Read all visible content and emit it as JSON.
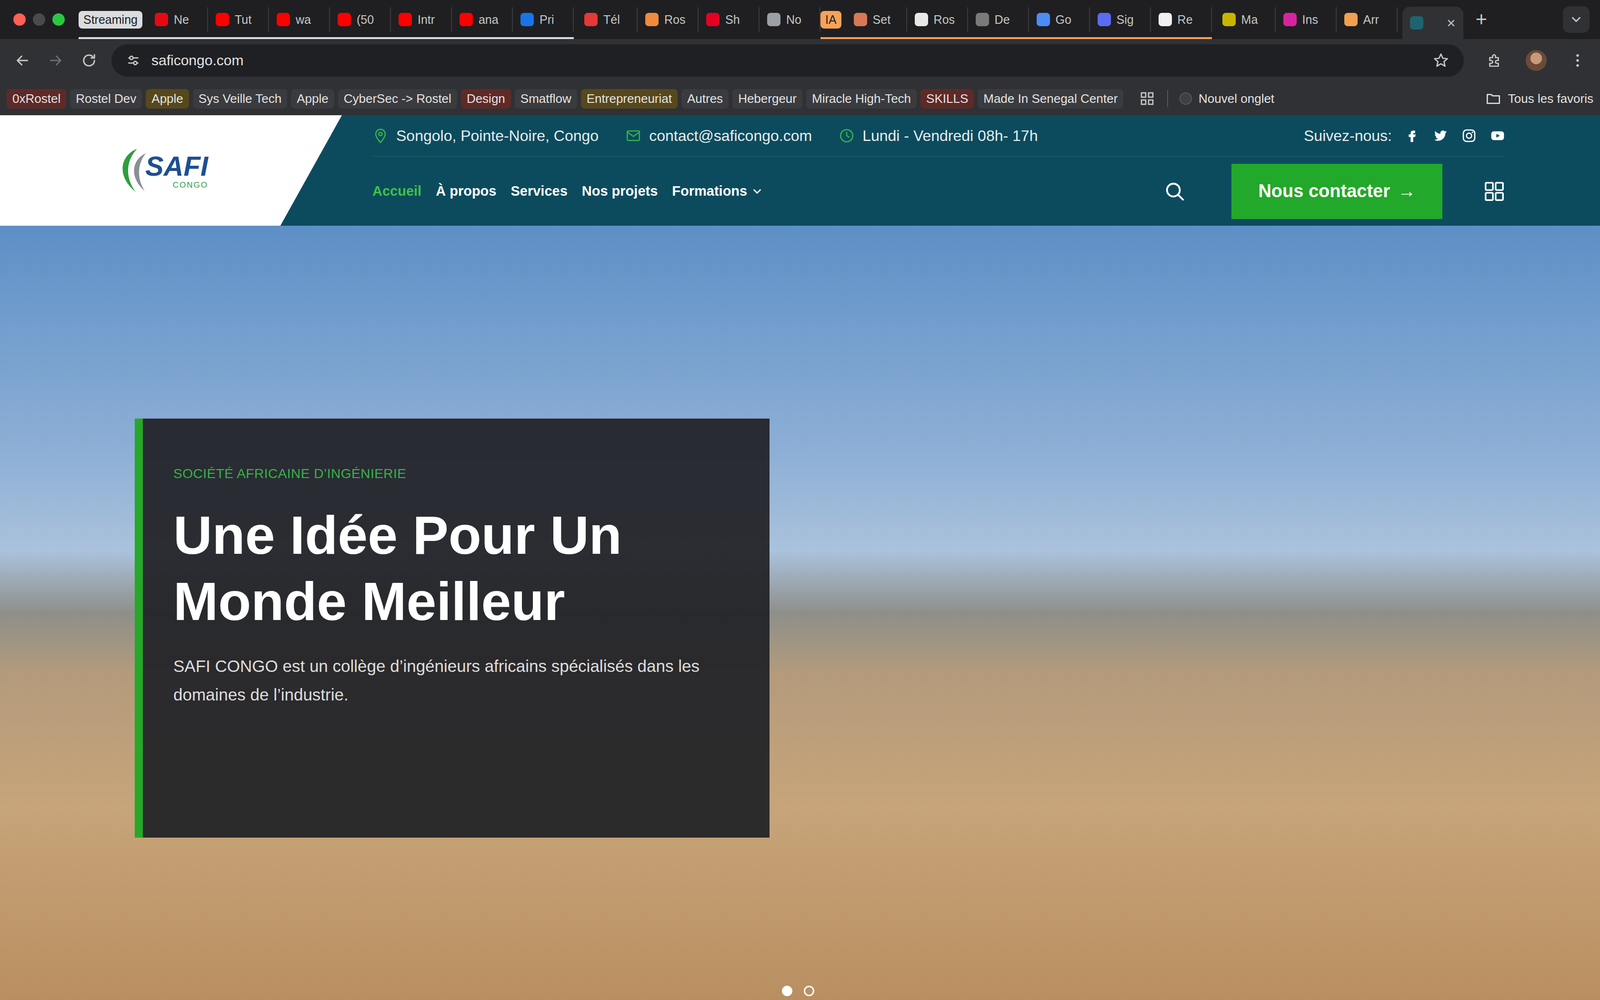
{
  "browser": {
    "tabstrip": [
      {
        "kind": "group",
        "label": "Streaming",
        "color": "#dadce0",
        "tabs": [
          {
            "label": "Ne",
            "color": "#e50914",
            "selected": false
          },
          {
            "label": "Tut",
            "color": "#ff0000",
            "selected": false
          },
          {
            "label": "wa",
            "color": "#ff0000",
            "selected": false
          },
          {
            "label": "(50",
            "color": "#ff0000",
            "selected": false
          },
          {
            "label": "Intr",
            "color": "#ff0000",
            "selected": false
          },
          {
            "label": "ana",
            "color": "#ff0000",
            "selected": false
          },
          {
            "label": "Pri",
            "color": "#1a73e8",
            "selected": false
          }
        ]
      },
      {
        "kind": "tab",
        "label": "Tél",
        "color": "#e53935",
        "selected": false
      },
      {
        "kind": "tab",
        "label": "Ros",
        "color": "#f08a3c",
        "selected": false
      },
      {
        "kind": "tab",
        "label": "Sh",
        "color": "#e60023",
        "selected": false
      },
      {
        "kind": "tab",
        "label": "No",
        "color": "#9aa0a6",
        "selected": false
      },
      {
        "kind": "group",
        "label": "IA",
        "color": "#f6a25a",
        "tabs": [
          {
            "label": "Set",
            "color": "#d97757",
            "selected": false
          },
          {
            "label": "Ros",
            "color": "#e8e8e8",
            "selected": false
          },
          {
            "label": "De",
            "color": "#7a7a7a",
            "selected": false
          },
          {
            "label": "Go",
            "color": "#4e8cf5",
            "selected": false
          },
          {
            "label": "Sig",
            "color": "#5b6cf0",
            "selected": false
          },
          {
            "label": "Re",
            "color": "#f0f0f0",
            "selected": false
          }
        ]
      },
      {
        "kind": "tab",
        "label": "Ma",
        "color": "#c8b400",
        "selected": false
      },
      {
        "kind": "tab",
        "label": "Ins",
        "color": "#d6249f",
        "selected": false
      },
      {
        "kind": "tab",
        "label": "Arr",
        "color": "#f0a050",
        "selected": false
      },
      {
        "kind": "tab",
        "label": "",
        "color": "#1e6470",
        "selected": true
      }
    ],
    "close_glyph": "×",
    "new_tab": "+",
    "back": {
      "disabled": false
    },
    "forward": {
      "disabled": true
    },
    "url": "saficongo.com",
    "bookmarks": [
      {
        "label": "0xRostel",
        "color": "#5e2a28"
      },
      {
        "label": "Rostel Dev",
        "color": "#3a3b3e"
      },
      {
        "label": "Apple",
        "color": "#56481c"
      },
      {
        "label": "Sys Veille Tech",
        "color": "#3a3b3e"
      },
      {
        "label": "Apple",
        "color": "#3a3b3e"
      },
      {
        "label": "CyberSec -> Rostel",
        "color": "#3a3b3e"
      },
      {
        "label": "Design",
        "color": "#5e2a28"
      },
      {
        "label": "Smatflow",
        "color": "#3a3b3e"
      },
      {
        "label": "Entrepreneuriat",
        "color": "#56481c"
      },
      {
        "label": "Autres",
        "color": "#3a3b3e"
      },
      {
        "label": "Hebergeur",
        "color": "#3a3b3e"
      },
      {
        "label": "Miracle High-Tech",
        "color": "#3a3b3e"
      },
      {
        "label": "SKILLS",
        "color": "#5e2a28"
      },
      {
        "label": "Made In Senegal Center",
        "color": "#3a3b3e"
      }
    ],
    "new_tab_bookmark": "Nouvel onglet",
    "all_bookmarks": "Tous les favoris"
  },
  "site": {
    "logo": {
      "name": "SAFI",
      "sub": "CONGO"
    },
    "contacts": [
      {
        "kind": "location",
        "text": "Songolo, Pointe-Noire, Congo"
      },
      {
        "kind": "email",
        "text": "contact@saficongo.com"
      },
      {
        "kind": "clock",
        "text": "Lundi - Vendredi 08h- 17h"
      }
    ],
    "social": {
      "label": "Suivez-nous:",
      "networks": [
        {
          "kind": "facebook"
        },
        {
          "kind": "twitter"
        },
        {
          "kind": "instagram"
        },
        {
          "kind": "youtube"
        }
      ]
    },
    "nav": [
      {
        "label": "Accueil",
        "selected": true,
        "dropdown": false
      },
      {
        "label": "À propos",
        "selected": false,
        "dropdown": false
      },
      {
        "label": "Services",
        "selected": false,
        "dropdown": false
      },
      {
        "label": "Nos projets",
        "selected": false,
        "dropdown": false
      },
      {
        "label": "Formations",
        "selected": false,
        "dropdown": true
      }
    ],
    "cta": {
      "label": "Nous contacter",
      "arrow": "→"
    },
    "hero": {
      "eyebrow": "SOCIÉTÉ AFRICAINE D’INGÉNIERIE",
      "title": "Une Idée Pour Un Monde Meilleur",
      "text": "SAFI CONGO est un collège d’ingénieurs africains spécialisés dans les domaines de l’industrie.",
      "slides": [
        {
          "selected": true
        },
        {
          "selected": false
        }
      ]
    }
  }
}
